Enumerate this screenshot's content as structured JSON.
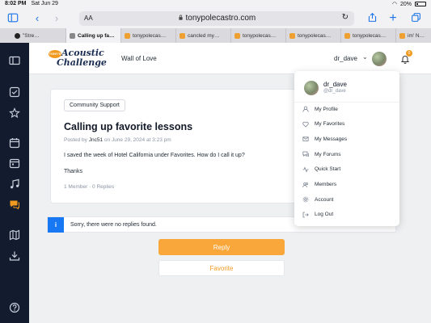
{
  "status": {
    "time": "8:02 PM",
    "date": "Sat Jun 29",
    "battery": "20%",
    "battery_level": 0.2
  },
  "browser": {
    "text_size_label": "AA",
    "url": "tonypolecastro.com",
    "tabs": [
      {
        "label": "\"Stre…",
        "favicon": "dark"
      },
      {
        "label": "Calling up fa…",
        "favicon": "gray",
        "active": true
      },
      {
        "label": "tonypolecas…",
        "favicon": "orange"
      },
      {
        "label": "cancled my…",
        "favicon": "orange"
      },
      {
        "label": "tonypolecas…",
        "favicon": "orange"
      },
      {
        "label": "tonypolecas…",
        "favicon": "orange"
      },
      {
        "label": "tonypolecas…",
        "favicon": "orange"
      },
      {
        "label": "im' N…",
        "favicon": "orange"
      }
    ]
  },
  "header": {
    "logo_badge": "TONY'S",
    "logo_line1": "Acoustic",
    "logo_line2": "Challenge",
    "nav_link": "Wall of Love",
    "username": "dr_dave",
    "notification_count": "0"
  },
  "post": {
    "forum_chip": "Community Support",
    "title": "Calling up favorite lessons",
    "posted_prefix": "Posted by",
    "author": "Jnc51",
    "posted_suffix": "on June 29, 2024 at 3:23 pm",
    "body": "I saved the week of Hotel California under Favorites. How do I call it up?",
    "signoff": "Thanks",
    "meta": "1 Member · 0 Replies"
  },
  "notice": {
    "icon_label": "i",
    "text": "Sorry, there were no replies found."
  },
  "actions": {
    "reply_label": "Reply",
    "favorite_label": "Favorite"
  },
  "dropdown": {
    "name": "dr_dave",
    "handle": "@dr_dave",
    "items": [
      {
        "label": "My Profile",
        "icon": "user-icon"
      },
      {
        "label": "My Favorites",
        "icon": "heart-icon"
      },
      {
        "label": "My Messages",
        "icon": "envelope-icon"
      },
      {
        "label": "My Forums",
        "icon": "chat-icon"
      },
      {
        "label": "Quick Start",
        "icon": "pulse-icon"
      },
      {
        "label": "Members",
        "icon": "members-icon"
      },
      {
        "label": "Account",
        "icon": "gear-icon"
      },
      {
        "label": "Log Out",
        "icon": "logout-icon"
      }
    ]
  },
  "colors": {
    "accent": "#f9a63a",
    "nav_bg": "#131b2e",
    "info": "#1877f2"
  }
}
